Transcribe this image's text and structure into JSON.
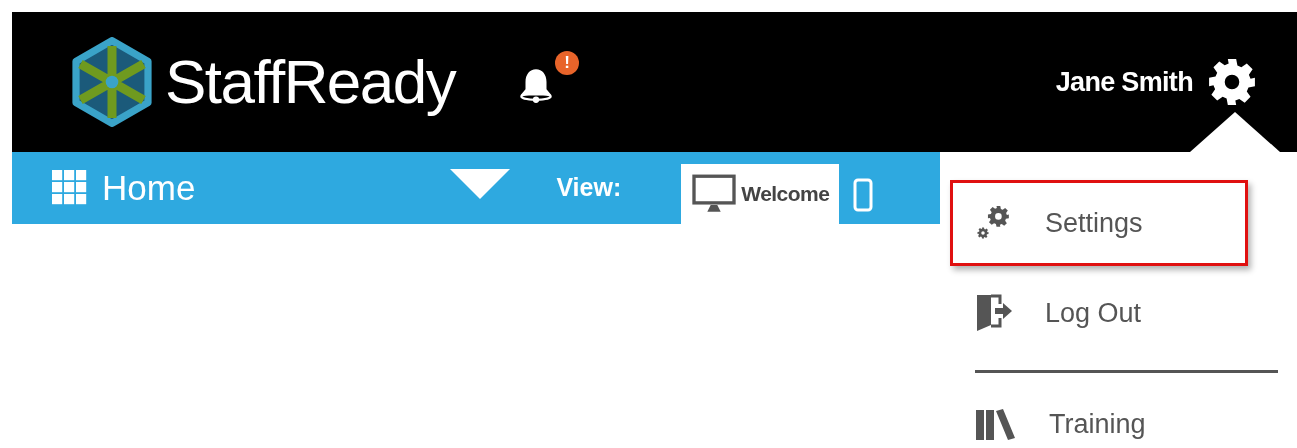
{
  "header": {
    "logo": "StaffReady",
    "notification_badge": "!",
    "user_name": "Jane Smith"
  },
  "nav": {
    "title": "Home",
    "view_label": "View:",
    "tabs": [
      {
        "label": "Welcome",
        "selected": true
      },
      {
        "selected": false
      }
    ]
  },
  "user_menu": {
    "items": [
      {
        "kind": "link",
        "label": "Settings",
        "selected": true
      },
      {
        "kind": "link",
        "label": "Log Out",
        "selected": false
      },
      {
        "kind": "separator"
      },
      {
        "kind": "link",
        "label": "Training",
        "selected": false
      }
    ]
  }
}
